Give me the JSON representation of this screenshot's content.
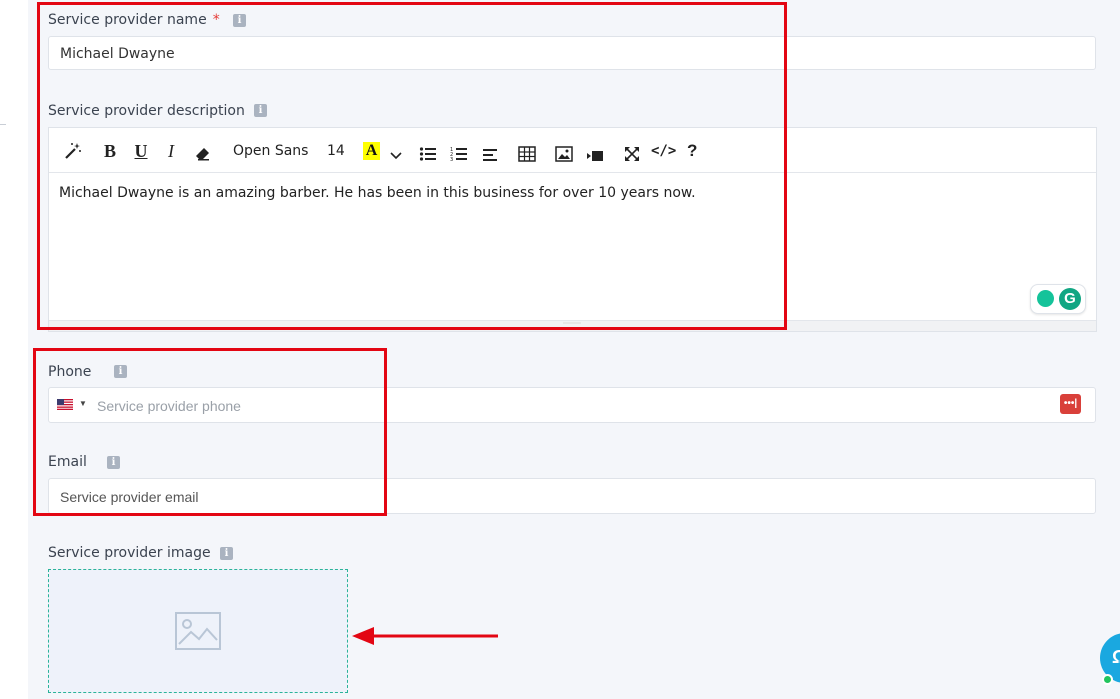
{
  "name_field": {
    "label": "Service provider name",
    "required_mark": "*",
    "value": "Michael Dwayne"
  },
  "description_field": {
    "label": "Service provider description",
    "toolbar": {
      "font_family": "Open Sans",
      "font_size": "14",
      "color_letter": "A",
      "bold": "B",
      "underline": "U",
      "italic": "I",
      "help": "?",
      "code": "</>"
    },
    "content": "Michael Dwayne is an amazing barber. He has been in this business for over 10 years now."
  },
  "phone_field": {
    "label": "Phone",
    "placeholder": "Service provider phone",
    "country_flag": "us-flag"
  },
  "email_field": {
    "label": "Email",
    "placeholder": "Service provider email"
  },
  "image_field": {
    "label": "Service provider image",
    "icon": "image-placeholder-icon"
  },
  "colors": {
    "annotation_red": "#e30613",
    "upload_border": "#2bb39a",
    "chat_blue": "#1aa8e0"
  }
}
